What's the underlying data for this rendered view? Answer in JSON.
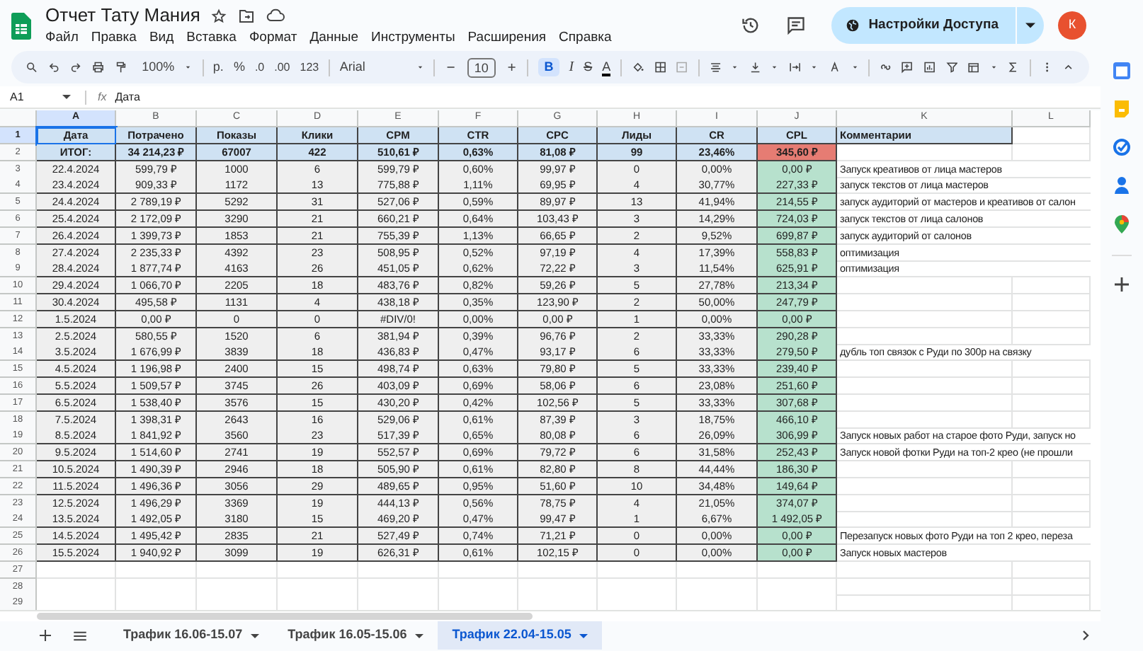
{
  "title": "Отчет Тату Мания",
  "menu": [
    "Файл",
    "Правка",
    "Вид",
    "Вставка",
    "Формат",
    "Данные",
    "Инструменты",
    "Расширения",
    "Справка"
  ],
  "share_button": "Настройки Доступа",
  "avatar": "К",
  "toolbar": {
    "zoom": "100%",
    "currency": "р.",
    "percent": "%",
    "decrease_decimals": ".0",
    "increase_decimals": ".00",
    "number_format": "123",
    "font": "Arial",
    "font_size": "10",
    "bold": "B",
    "bold_on": true,
    "italic": "I",
    "strikethrough": "S",
    "text_color": "A"
  },
  "formula_bar": {
    "cell_ref": "A1",
    "fx": "fx",
    "value": "Дата"
  },
  "columns": [
    {
      "letter": "A",
      "selected": true
    },
    {
      "letter": "B",
      "selected": false
    },
    {
      "letter": "C",
      "selected": false
    },
    {
      "letter": "D",
      "selected": false
    },
    {
      "letter": "E",
      "selected": false
    },
    {
      "letter": "F",
      "selected": false
    },
    {
      "letter": "G",
      "selected": false
    },
    {
      "letter": "H",
      "selected": false
    },
    {
      "letter": "I",
      "selected": false
    },
    {
      "letter": "J",
      "selected": false
    },
    {
      "letter": "K",
      "selected": false
    },
    {
      "letter": "L",
      "selected": false
    }
  ],
  "rows": [
    {
      "number": "1",
      "selected": true,
      "kind": "header",
      "cells": [
        "Дата",
        "Потрачено",
        "Показы",
        "Клики",
        "CPM",
        "CTR",
        "CPC",
        "Лиды",
        "CR",
        "CPL"
      ],
      "comment": "Комментарии"
    },
    {
      "number": "2",
      "selected": false,
      "kind": "total",
      "cells": [
        "ИТОГ:",
        "34 214,23 ₽",
        "67007",
        "422",
        "510,61 ₽",
        "0,63%",
        "81,08 ₽",
        "99",
        "23,46%",
        "345,60 ₽"
      ]
    },
    {
      "number": "3",
      "selected": false,
      "kind": "data",
      "cells": [
        "22.4.2024",
        "599,79 ₽",
        "1000",
        "6",
        "599,79 ₽",
        "0,60%",
        "99,97 ₽",
        "0",
        "0,00%",
        "0,00 ₽"
      ],
      "comment": "Запуск креативов от лица мастеров"
    },
    {
      "number": "4",
      "selected": false,
      "kind": "data",
      "cells": [
        "23.4.2024",
        "909,33 ₽",
        "1172",
        "13",
        "775,88 ₽",
        "1,11%",
        "69,95 ₽",
        "4",
        "30,77%",
        "227,33 ₽"
      ],
      "comment": "запуск текстов от лица мастеров"
    },
    {
      "number": "5",
      "selected": false,
      "kind": "data",
      "cells": [
        "24.4.2024",
        "2 789,19 ₽",
        "5292",
        "31",
        "527,06 ₽",
        "0,59%",
        "89,97 ₽",
        "13",
        "41,94%",
        "214,55 ₽"
      ],
      "comment": "запуск аудиторий от мастеров и креативов от салон"
    },
    {
      "number": "6",
      "selected": false,
      "kind": "data",
      "cells": [
        "25.4.2024",
        "2 172,09 ₽",
        "3290",
        "21",
        "660,21 ₽",
        "0,64%",
        "103,43 ₽",
        "3",
        "14,29%",
        "724,03 ₽"
      ],
      "comment": "запуск текстов от лица салонов"
    },
    {
      "number": "7",
      "selected": false,
      "kind": "data",
      "cells": [
        "26.4.2024",
        "1 399,73 ₽",
        "1853",
        "21",
        "755,39 ₽",
        "1,13%",
        "66,65 ₽",
        "2",
        "9,52%",
        "699,87 ₽"
      ],
      "comment": "запуск аудиторий от салонов"
    },
    {
      "number": "8",
      "selected": false,
      "kind": "data",
      "cells": [
        "27.4.2024",
        "2 235,33 ₽",
        "4392",
        "23",
        "508,95 ₽",
        "0,52%",
        "97,19 ₽",
        "4",
        "17,39%",
        "558,83 ₽"
      ],
      "comment": "оптимизация"
    },
    {
      "number": "9",
      "selected": false,
      "kind": "data",
      "cells": [
        "28.4.2024",
        "1 877,74 ₽",
        "4163",
        "26",
        "451,05 ₽",
        "0,62%",
        "72,22 ₽",
        "3",
        "11,54%",
        "625,91 ₽"
      ],
      "comment": "оптимизация"
    },
    {
      "number": "10",
      "selected": false,
      "kind": "data",
      "cells": [
        "29.4.2024",
        "1 066,70 ₽",
        "2205",
        "18",
        "483,76 ₽",
        "0,82%",
        "59,26 ₽",
        "5",
        "27,78%",
        "213,34 ₽"
      ]
    },
    {
      "number": "11",
      "selected": false,
      "kind": "data",
      "cells": [
        "30.4.2024",
        "495,58 ₽",
        "1131",
        "4",
        "438,18 ₽",
        "0,35%",
        "123,90 ₽",
        "2",
        "50,00%",
        "247,79 ₽"
      ]
    },
    {
      "number": "12",
      "selected": false,
      "kind": "data",
      "cells": [
        "1.5.2024",
        "0,00 ₽",
        "0",
        "0",
        "#DIV/0!",
        "0,00%",
        "0,00 ₽",
        "1",
        "0,00%",
        "0,00 ₽"
      ]
    },
    {
      "number": "13",
      "selected": false,
      "kind": "data",
      "cells": [
        "2.5.2024",
        "580,55 ₽",
        "1520",
        "6",
        "381,94 ₽",
        "0,39%",
        "96,76 ₽",
        "2",
        "33,33%",
        "290,28 ₽"
      ]
    },
    {
      "number": "14",
      "selected": false,
      "kind": "data",
      "cells": [
        "3.5.2024",
        "1 676,99 ₽",
        "3839",
        "18",
        "436,83 ₽",
        "0,47%",
        "93,17 ₽",
        "6",
        "33,33%",
        "279,50 ₽"
      ],
      "comment": "дубль топ связок с Руди по 300р на связку"
    },
    {
      "number": "15",
      "selected": false,
      "kind": "data",
      "cells": [
        "4.5.2024",
        "1 196,98 ₽",
        "2400",
        "15",
        "498,74 ₽",
        "0,63%",
        "79,80 ₽",
        "5",
        "33,33%",
        "239,40 ₽"
      ]
    },
    {
      "number": "16",
      "selected": false,
      "kind": "data",
      "cells": [
        "5.5.2024",
        "1 509,57 ₽",
        "3745",
        "26",
        "403,09 ₽",
        "0,69%",
        "58,06 ₽",
        "6",
        "23,08%",
        "251,60 ₽"
      ]
    },
    {
      "number": "17",
      "selected": false,
      "kind": "data",
      "cells": [
        "6.5.2024",
        "1 538,40 ₽",
        "3576",
        "15",
        "430,20 ₽",
        "0,42%",
        "102,56 ₽",
        "5",
        "33,33%",
        "307,68 ₽"
      ]
    },
    {
      "number": "18",
      "selected": false,
      "kind": "data",
      "cells": [
        "7.5.2024",
        "1 398,31 ₽",
        "2643",
        "16",
        "529,06 ₽",
        "0,61%",
        "87,39 ₽",
        "3",
        "18,75%",
        "466,10 ₽"
      ]
    },
    {
      "number": "19",
      "selected": false,
      "kind": "data",
      "cells": [
        "8.5.2024",
        "1 841,92 ₽",
        "3560",
        "23",
        "517,39 ₽",
        "0,65%",
        "80,08 ₽",
        "6",
        "26,09%",
        "306,99 ₽"
      ],
      "comment": "Запуск новых работ на старое фото Руди, запуск но"
    },
    {
      "number": "20",
      "selected": false,
      "kind": "data",
      "cells": [
        "9.5.2024",
        "1 514,60 ₽",
        "2741",
        "19",
        "552,57 ₽",
        "0,69%",
        "79,72 ₽",
        "6",
        "31,58%",
        "252,43 ₽"
      ],
      "comment": "Запуск новой фотки Руди на топ-2 крео (не прошли"
    },
    {
      "number": "21",
      "selected": false,
      "kind": "data",
      "cells": [
        "10.5.2024",
        "1 490,39 ₽",
        "2946",
        "18",
        "505,90 ₽",
        "0,61%",
        "82,80 ₽",
        "8",
        "44,44%",
        "186,30 ₽"
      ]
    },
    {
      "number": "22",
      "selected": false,
      "kind": "data",
      "cells": [
        "11.5.2024",
        "1 496,36 ₽",
        "3056",
        "29",
        "489,65 ₽",
        "0,95%",
        "51,60 ₽",
        "10",
        "34,48%",
        "149,64 ₽"
      ]
    },
    {
      "number": "23",
      "selected": false,
      "kind": "data",
      "cells": [
        "12.5.2024",
        "1 496,29 ₽",
        "3369",
        "19",
        "444,13 ₽",
        "0,56%",
        "78,75 ₽",
        "4",
        "21,05%",
        "374,07 ₽"
      ]
    },
    {
      "number": "24",
      "selected": false,
      "kind": "data",
      "cells": [
        "13.5.2024",
        "1 492,05 ₽",
        "3180",
        "15",
        "469,20 ₽",
        "0,47%",
        "99,47 ₽",
        "1",
        "6,67%",
        "1 492,05 ₽"
      ]
    },
    {
      "number": "25",
      "selected": false,
      "kind": "data",
      "cells": [
        "14.5.2024",
        "1 495,42 ₽",
        "2835",
        "21",
        "527,49 ₽",
        "0,74%",
        "71,21 ₽",
        "0",
        "0,00%",
        "0,00 ₽"
      ],
      "comment": "Перезапуск новых фото Руди на топ 2 крео, переза"
    },
    {
      "number": "26",
      "selected": false,
      "kind": "data",
      "cells": [
        "15.5.2024",
        "1 940,92 ₽",
        "3099",
        "19",
        "626,31 ₽",
        "0,61%",
        "102,15 ₽",
        "0",
        "0,00%",
        "0,00 ₽"
      ],
      "comment": "Запуск новых мастеров"
    },
    {
      "number": "27",
      "selected": false,
      "kind": "empty"
    },
    {
      "number": "28",
      "selected": false,
      "kind": "empty"
    },
    {
      "number": "29",
      "selected": false,
      "kind": "empty"
    }
  ],
  "sheet_tabs": [
    {
      "label": "Трафик 16.06-15.07",
      "selected": false
    },
    {
      "label": "Трафик 16.05-15.06",
      "selected": false
    },
    {
      "label": "Трафик 22.04-15.05",
      "selected": true
    }
  ]
}
